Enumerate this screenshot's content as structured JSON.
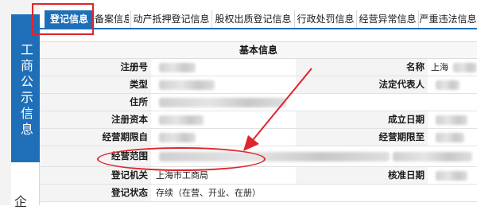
{
  "sidebar": {
    "title": "工商公示信息",
    "lower_char": "企"
  },
  "tabs": [
    {
      "label": "登记信息",
      "active": true
    },
    {
      "label": "备案信息",
      "active": false
    },
    {
      "label": "动产抵押登记信息",
      "active": false
    },
    {
      "label": "股权出质登记信息",
      "active": false
    },
    {
      "label": "行政处罚信息",
      "active": false
    },
    {
      "label": "经营异常信息",
      "active": false
    },
    {
      "label": "严重违法信息",
      "active": false
    }
  ],
  "section": {
    "title": "基本信息",
    "rows": [
      {
        "left_label": "注册号",
        "left_value": "",
        "right_label": "名称",
        "right_value": "上海"
      },
      {
        "left_label": "类型",
        "left_value": "",
        "right_label": "法定代表人",
        "right_value": ""
      },
      {
        "left_label": "住所",
        "left_value": "",
        "right_label": "",
        "right_value": ""
      },
      {
        "left_label": "注册资本",
        "left_value": "",
        "right_label": "成立日期",
        "right_value": ""
      },
      {
        "left_label": "经营期限自",
        "left_value": "",
        "right_label": "经营期限至",
        "right_value": ""
      },
      {
        "left_label": "经营范围",
        "left_value": "",
        "right_label": "",
        "right_value": ""
      },
      {
        "left_label": "登记机关",
        "left_value": "上海市工商局",
        "right_label": "核准日期",
        "right_value": ""
      },
      {
        "left_label": "登记状态",
        "left_value": "存续（在营、开业、在册）",
        "right_label": "",
        "right_value": ""
      }
    ]
  },
  "colors": {
    "accent": "#1f6fb8",
    "annotation": "#e0242b"
  }
}
